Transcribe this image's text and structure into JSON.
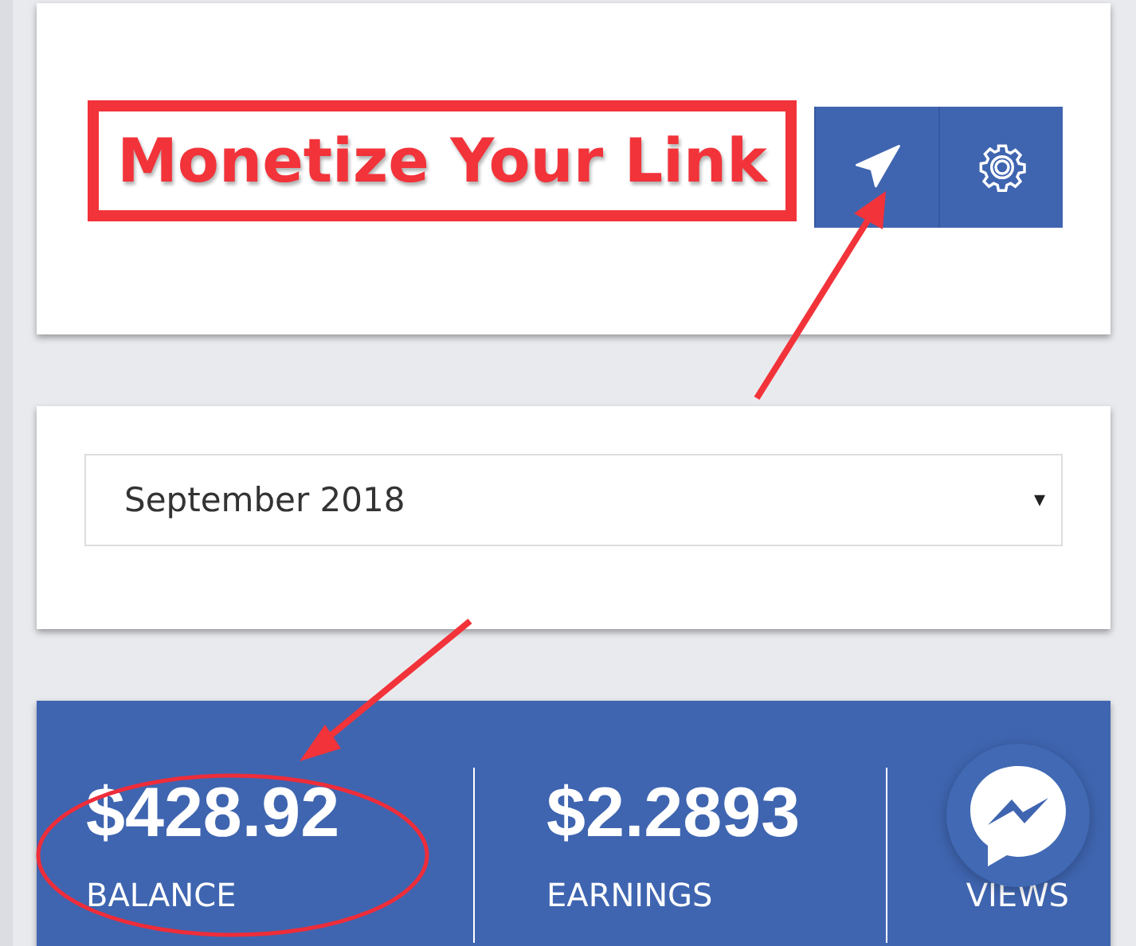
{
  "annotation": {
    "label": "Monetize Your Link"
  },
  "month_select": {
    "value": "September 2018",
    "caret": "▾"
  },
  "stats": [
    {
      "value": "$428.92",
      "label": "BALANCE",
      "highlighted": true
    },
    {
      "value": "$2.2893",
      "label": "EARNINGS",
      "highlighted": false
    },
    {
      "label": "VIEWS",
      "highlighted": false
    }
  ]
}
